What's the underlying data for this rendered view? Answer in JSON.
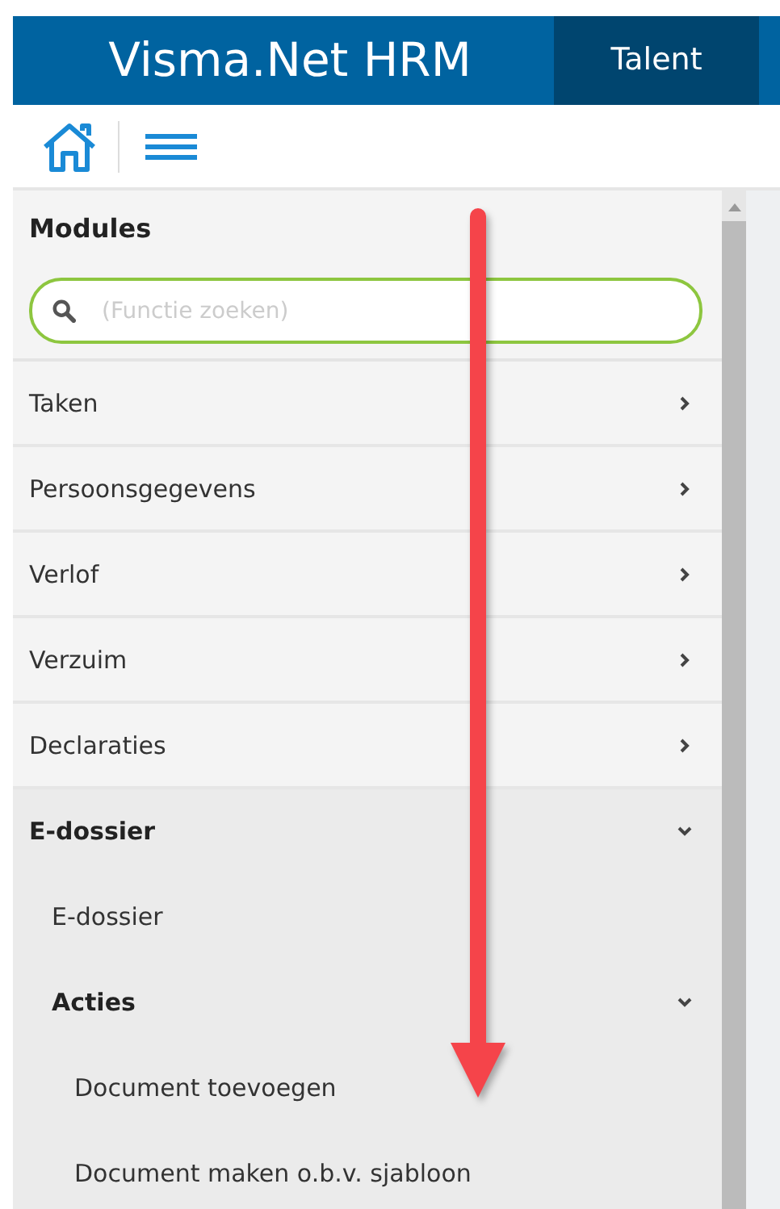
{
  "header": {
    "title": "Visma.Net HRM",
    "tab": "Talent"
  },
  "sidebar": {
    "heading": "Modules",
    "search": {
      "placeholder": "(Functie zoeken)"
    },
    "items": [
      {
        "label": "Taken",
        "kind": "group",
        "expanded": false
      },
      {
        "label": "Persoonsgegevens",
        "kind": "group",
        "expanded": false
      },
      {
        "label": "Verlof",
        "kind": "group",
        "expanded": false
      },
      {
        "label": "Verzuim",
        "kind": "group",
        "expanded": false
      },
      {
        "label": "Declaraties",
        "kind": "group",
        "expanded": false
      },
      {
        "label": "E-dossier",
        "kind": "group",
        "expanded": true,
        "children": [
          {
            "label": "E-dossier",
            "kind": "link"
          },
          {
            "label": "Acties",
            "kind": "group",
            "expanded": true,
            "children": [
              {
                "label": "Document toevoegen",
                "kind": "link"
              },
              {
                "label": "Document maken o.b.v. sjabloon",
                "kind": "link"
              }
            ]
          }
        ]
      }
    ]
  }
}
